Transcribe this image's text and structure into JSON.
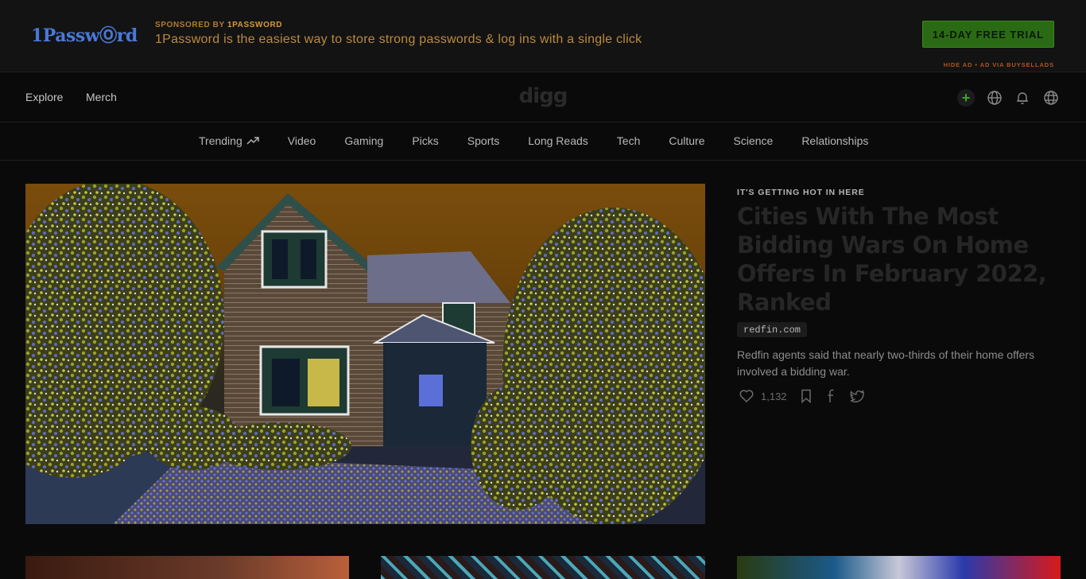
{
  "ad": {
    "logo": "1PasswⓄrd",
    "sponsor_prefix": "SPONSORED BY",
    "sponsor_name": "1PASSWORD",
    "text": "1Password is the easiest way to store strong passwords & log ins with a single click",
    "cta_label": "14-DAY FREE TRIAL",
    "meta": "HIDE AD • AD VIA BUYSELLADS"
  },
  "header": {
    "nav": [
      "Explore",
      "Merch"
    ],
    "logo": "digg",
    "icons": [
      "add-icon",
      "globe-icon",
      "notification-icon",
      "user-globe-icon"
    ]
  },
  "categories": [
    "Trending",
    "Video",
    "Gaming",
    "Picks",
    "Sports",
    "Long Reads",
    "Tech",
    "Culture",
    "Science",
    "Relationships"
  ],
  "hero": {
    "kicker": "IT'S GETTING HOT IN HERE",
    "title": "Cities With The Most Bidding Wars On Home Offers In February 2022, Ranked",
    "domain": "redfin.com",
    "description": "Redfin agents said that nearly two-thirds of their home offers involved a bidding war.",
    "likes": "1,132"
  },
  "colors": {
    "accent_green": "#2a6a14",
    "ad_orange": "#bb8a3c",
    "background": "#0a0a0a"
  }
}
